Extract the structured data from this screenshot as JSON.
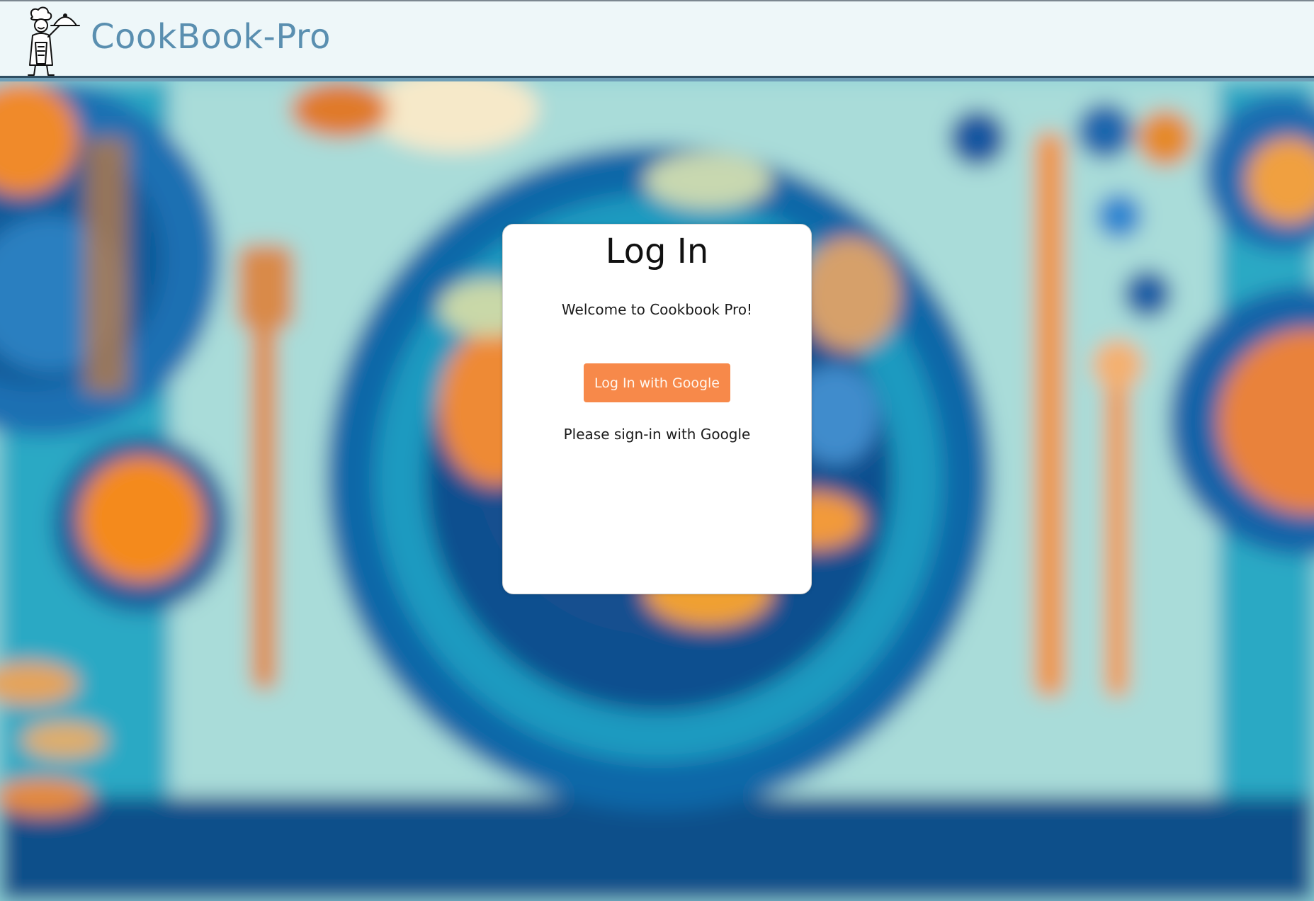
{
  "header": {
    "brand": "CookBook-Pro",
    "logo_icon": "chef-with-cloche-icon"
  },
  "login": {
    "title": "Log In",
    "welcome": "Welcome to Cookbook Pro!",
    "google_button": "Log In with Google",
    "hint": "Please sign-in with Google"
  },
  "colors": {
    "brand_text": "#5a8fb0",
    "header_bg": "#eef7f9",
    "button_bg": "#f7894a",
    "card_bg": "#ffffff"
  }
}
